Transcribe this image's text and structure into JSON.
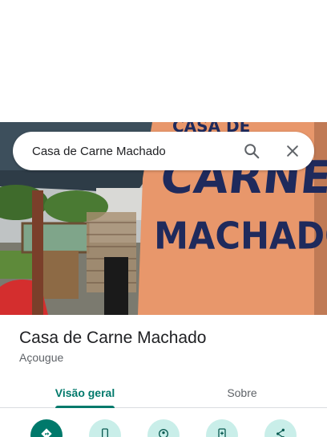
{
  "search": {
    "query": "Casa de Carne Machado",
    "search_icon": "search-icon",
    "close_icon": "close-icon"
  },
  "photo": {
    "sign_lines": [
      "CASA DE",
      "CARNE",
      "MACHADO"
    ]
  },
  "place": {
    "name": "Casa de Carne Machado",
    "category": "Açougue"
  },
  "tabs": [
    {
      "label": "Visão geral",
      "selected": true
    },
    {
      "label": "Sobre",
      "selected": false
    }
  ],
  "actions": [
    {
      "icon": "directions-icon"
    },
    {
      "icon": "phone-icon"
    },
    {
      "icon": "location-icon"
    },
    {
      "icon": "add-to-phone-icon"
    },
    {
      "icon": "share-icon"
    }
  ],
  "colors": {
    "accent": "#00796b",
    "accent_light": "#c9eee9",
    "text_primary": "#202124",
    "text_secondary": "#5f6368"
  }
}
